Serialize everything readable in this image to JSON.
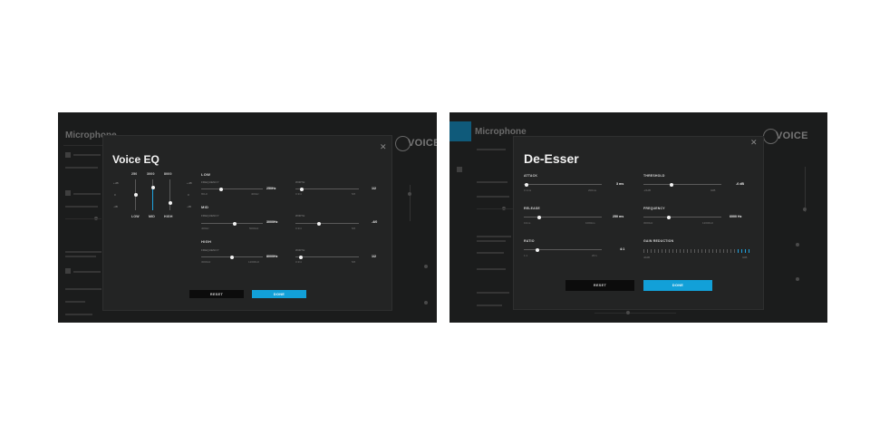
{
  "left_screenshot": {
    "background": {
      "title": "Microphone",
      "brand": "VOICE"
    },
    "modal": {
      "title": "Voice EQ",
      "close_icon": "close-icon",
      "graph": {
        "top_labels": [
          "250",
          "3000",
          "8000"
        ],
        "bottom_labels": [
          "LOW",
          "MID",
          "HIGH"
        ],
        "db_labels": [
          "+dB",
          "0",
          "-dB"
        ],
        "levels": [
          0.5,
          0.75,
          0.25
        ]
      },
      "bands": [
        {
          "name": "LOW",
          "frequency_label": "FREQUENCY",
          "frequency_value": "250",
          "frequency_unit": "Hz",
          "frequency_min": "80Hz",
          "frequency_max": "400Hz",
          "frequency_pos": 0.32,
          "width_label": "WIDTH",
          "width_value": "1",
          "width_unit": "/2",
          "width_min": "0.3/4",
          "width_max": "5/6",
          "width_pos": 0.1
        },
        {
          "name": "MID",
          "frequency_label": "FREQUENCY",
          "frequency_value": "3000",
          "frequency_unit": "Hz",
          "frequency_min": "400Hz",
          "frequency_max": "5000Hz",
          "frequency_pos": 0.54,
          "width_label": "WIDTH",
          "width_value": "-4",
          "width_unit": "/0",
          "width_min": "0.3/4",
          "width_max": "5/6",
          "width_pos": 0.37
        },
        {
          "name": "HIGH",
          "frequency_label": "FREQUENCY",
          "frequency_value": "8000",
          "frequency_unit": "Hz",
          "frequency_min": "3000Hz",
          "frequency_max": "12000Hz",
          "frequency_pos": 0.5,
          "width_label": "WIDTH",
          "width_value": "1",
          "width_unit": "/2",
          "width_min": "0.3/4",
          "width_max": "5/6",
          "width_pos": 0.09
        }
      ],
      "reset_label": "RESET",
      "done_label": "DONE"
    }
  },
  "right_screenshot": {
    "background": {
      "title": "Microphone",
      "brand": "VOICE"
    },
    "modal": {
      "title": "De-Esser",
      "close_icon": "close-icon",
      "controls": [
        {
          "label": "ATTACK",
          "value": "3",
          "unit": "ms",
          "min": "0.1ms",
          "max": "200ms",
          "pos": 0.03
        },
        {
          "label": "THRESHOLD",
          "value": "-6",
          "unit": "dB",
          "min": "-24dB",
          "max": "0dB",
          "pos": 0.36
        },
        {
          "label": "RELEASE",
          "value": "250",
          "unit": "ms",
          "min": "10ms",
          "max": "1000ms",
          "pos": 0.2
        },
        {
          "label": "FREQUENCY",
          "value": "6000",
          "unit": "Hz",
          "min": "3000Hz",
          "max": "12000Hz",
          "pos": 0.33
        },
        {
          "label": "RATIO",
          "value": "4",
          "unit": ":1",
          "min": "1:1",
          "max": "20:1",
          "pos": 0.18
        }
      ],
      "gain_reduction": {
        "label": "GAIN REDUCTION",
        "min": "40dB",
        "max": "0dB",
        "tick_count": 30,
        "active_count": 4,
        "accent": "#1fa3e0"
      },
      "reset_label": "RESET",
      "done_label": "DONE"
    }
  },
  "colors": {
    "accent": "#12a0d8",
    "modal_bg": "#232424",
    "panel_bg": "#1b1c1c"
  }
}
